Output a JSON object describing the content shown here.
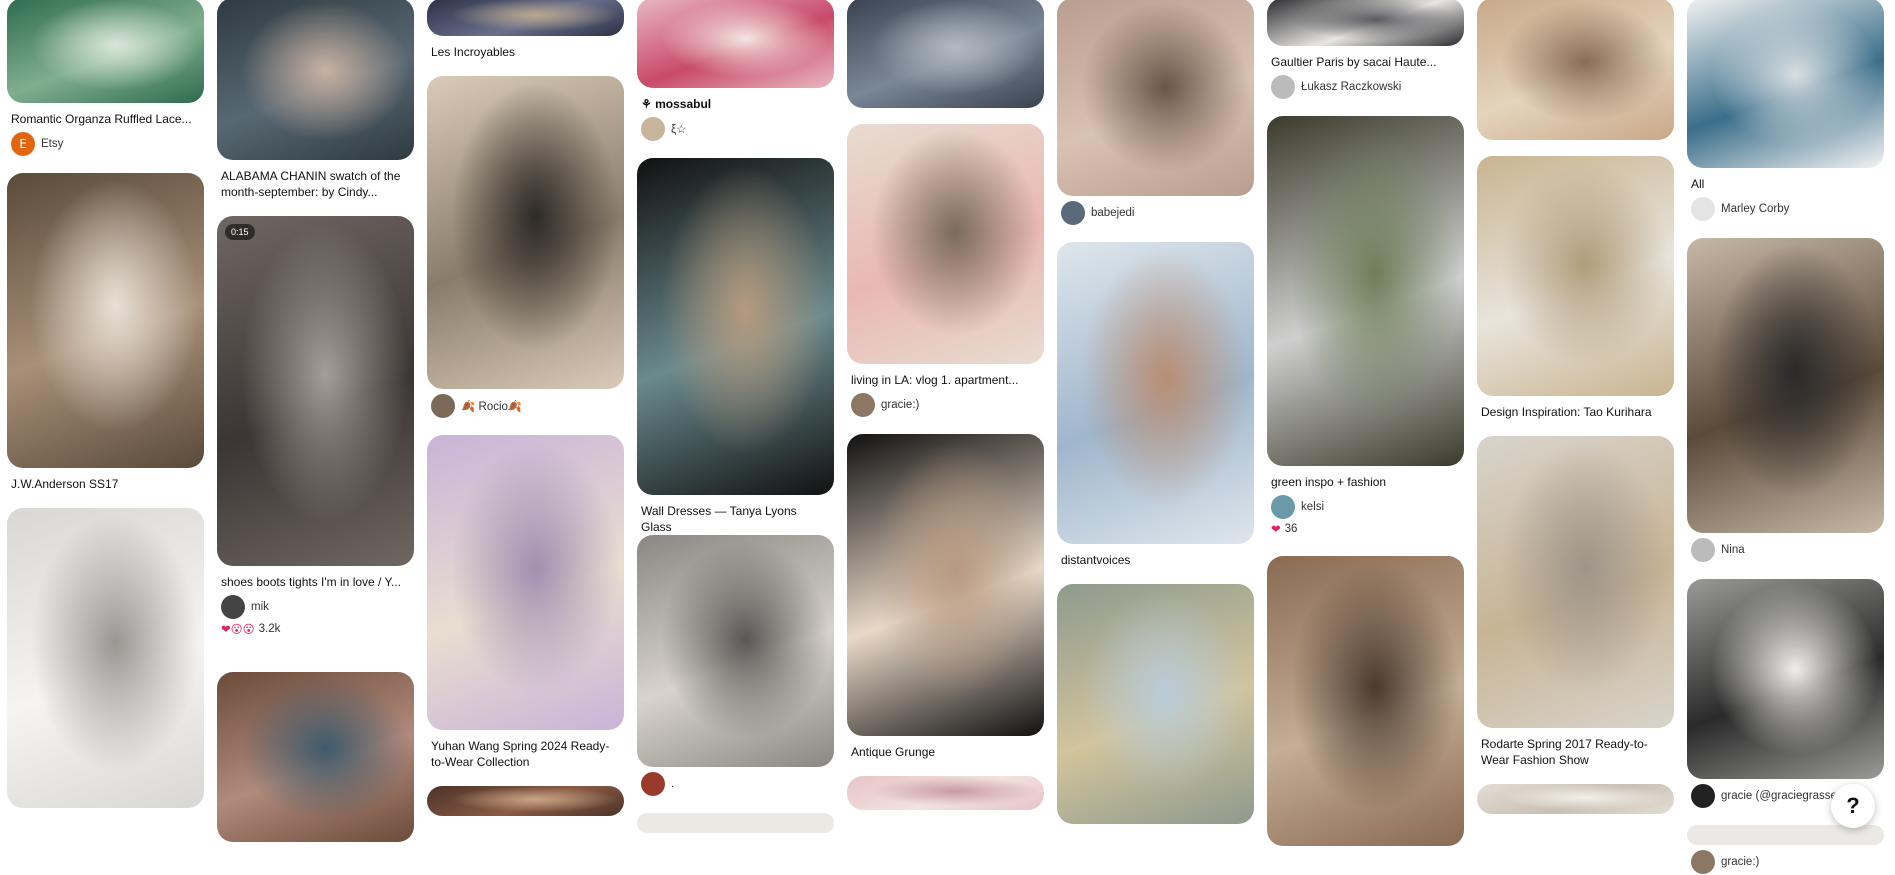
{
  "columns": [
    [
      {
        "h": 105,
        "offset": -2,
        "colors": [
          "#2f6b4e",
          "#7fae8f",
          "#d9e6d8"
        ],
        "title": "Romantic Organza Ruffled Lace...",
        "user": "Etsy",
        "avatar": "E",
        "avatar_color": "#e3650f"
      },
      {
        "h": 295,
        "colors": [
          "#5a4a3a",
          "#a89078",
          "#e8e0d6"
        ],
        "title": "J.W.Anderson SS17"
      },
      {
        "h": 300,
        "colors": [
          "#d9d7d4",
          "#f5f4f1",
          "#9a9793"
        ]
      }
    ],
    [
      {
        "h": 162,
        "offset": -2,
        "colors": [
          "#2e3a40",
          "#586872",
          "#c9b1a2"
        ],
        "title": "ALABAMA CHANIN swatch of the month-september: by Cindy..."
      },
      {
        "h": 350,
        "colors": [
          "#6f6762",
          "#3b3533",
          "#a39e98"
        ],
        "badge": "0:15",
        "title": "shoes boots tights I'm in love / Y...",
        "user": "mik",
        "avatar": "",
        "avatar_color": "#444",
        "reactions": "3.2k"
      },
      {
        "h": 170,
        "colors": [
          "#6b4b3a",
          "#b18a7c",
          "#3e5a6b"
        ]
      }
    ],
    [
      {
        "h": 38,
        "offset": -2,
        "colors": [
          "#2a3145",
          "#6a6f8c",
          "#b8a890"
        ],
        "title": "Les Incroyables"
      },
      {
        "h": 313,
        "colors": [
          "#d9cbb8",
          "#8a7c6a",
          "#2e2a27"
        ],
        "user": "🍂 Rocio🍂",
        "avatar": "",
        "avatar_color": "#7b6a58"
      },
      {
        "h": 295,
        "colors": [
          "#c9b3d8",
          "#e9ddd0",
          "#a08fb0"
        ],
        "title": "Yuhan Wang Spring 2024 Ready-to-Wear Collection"
      },
      {
        "h": 30,
        "colors": [
          "#4a3328",
          "#8a5a44",
          "#c8a488"
        ]
      }
    ],
    [
      {
        "h": 90,
        "offset": -2,
        "colors": [
          "#e8b8c0",
          "#c94a6a",
          "#f3e6e0"
        ],
        "user_bold": "⚘ mossabul",
        "user": "ξ☆",
        "avatar": "",
        "avatar_color": "#c8b49a"
      },
      {
        "h": 337,
        "colors": [
          "#111111",
          "#6a8a8e",
          "#b59a7e"
        ],
        "title": "Wall Dresses — Tanya Lyons Glass"
      },
      {
        "h": 232,
        "colors": [
          "#8a8782",
          "#d8d3cc",
          "#5a5855"
        ],
        "user": ".",
        "avatar": "",
        "avatar_color": "#9a3a2a"
      },
      {
        "h": 20,
        "colors": []
      }
    ],
    [
      {
        "h": 110,
        "offset": -2,
        "colors": [
          "#3a4250",
          "#7a8796",
          "#b3b9c2"
        ]
      },
      {
        "h": 240,
        "colors": [
          "#e8dcd0",
          "#e9b8b4",
          "#7a6a5e"
        ],
        "title": "living in LA: vlog 1. apartment...",
        "user": "gracie:)",
        "avatar": "",
        "avatar_color": "#8c7664"
      },
      {
        "h": 302,
        "colors": [
          "#111111",
          "#e8d8c8",
          "#b89a80"
        ],
        "title": "Antique Grunge"
      },
      {
        "h": 34,
        "colors": [
          "#e6c4c8",
          "#f2e2e0",
          "#c89aa0"
        ]
      }
    ],
    [
      {
        "h": 198,
        "offset": -2,
        "colors": [
          "#b89e8e",
          "#d9c2b4",
          "#6a5548"
        ],
        "user": "babejedi",
        "avatar": "",
        "avatar_color": "#5a6a7a"
      },
      {
        "h": 302,
        "colors": [
          "#dfe6ec",
          "#9fb6cc",
          "#b88e74"
        ],
        "title": "distantvoices"
      },
      {
        "h": 240,
        "colors": [
          "#8e9a8e",
          "#d2c49c",
          "#b8cbd8"
        ]
      }
    ],
    [
      {
        "h": 48,
        "offset": -2,
        "colors": [
          "#2a2a2e",
          "#e8e6e2",
          "#5a5a60"
        ],
        "title": "Gaultier Paris by sacai Haute...",
        "user": "Łukasz Raczkowski",
        "avatar": "",
        "avatar_color": "#bbbbbb"
      },
      {
        "h": 350,
        "colors": [
          "#3b3b2c",
          "#cfcfcf",
          "#6e7f5a"
        ],
        "title": "green inspo + fashion",
        "user": "kelsi",
        "avatar": "",
        "avatar_color": "#6a9aa8",
        "reactions": "36"
      },
      {
        "h": 290,
        "colors": [
          "#8a6a52",
          "#c4ae94",
          "#4a3a30"
        ]
      }
    ],
    [
      {
        "h": 142,
        "offset": -2,
        "colors": [
          "#c9a888",
          "#e4d4bc",
          "#8a6c54"
        ]
      },
      {
        "h": 240,
        "colors": [
          "#c9b490",
          "#e8e4dc",
          "#b09c7a"
        ],
        "title": "Design Inspiration: Tao Kurihara"
      },
      {
        "h": 292,
        "colors": [
          "#d8d4cc",
          "#c8b494",
          "#9e958a"
        ],
        "title": "Rodarte Spring 2017 Ready-to-Wear Fashion Show"
      },
      {
        "h": 30,
        "colors": [
          "#e4ddd4",
          "#c8c0b4",
          "#f4f0ea"
        ]
      }
    ],
    [
      {
        "h": 170,
        "offset": -2,
        "colors": [
          "#f2f2f2",
          "#3a6e8a",
          "#d8dee2"
        ],
        "title": "All",
        "user": "Marley Corby",
        "avatar": "",
        "avatar_color": "#e4e4e4"
      },
      {
        "h": 295,
        "colors": [
          "#c8b8a8",
          "#5a4a3a",
          "#2a2a2a"
        ],
        "user": "Nina",
        "avatar": "",
        "avatar_color": "#bbbbbb"
      },
      {
        "h": 200,
        "colors": [
          "#9a9a98",
          "#2a2a2a",
          "#f0eeea"
        ],
        "user": "gracie (@graciegrasseth) ·...",
        "avatar": "",
        "avatar_color": "#222222"
      },
      {
        "h": 20,
        "colors": [],
        "user": "gracie:)",
        "avatar": "",
        "avatar_color": "#8c7664"
      }
    ]
  ],
  "help_button": "?"
}
